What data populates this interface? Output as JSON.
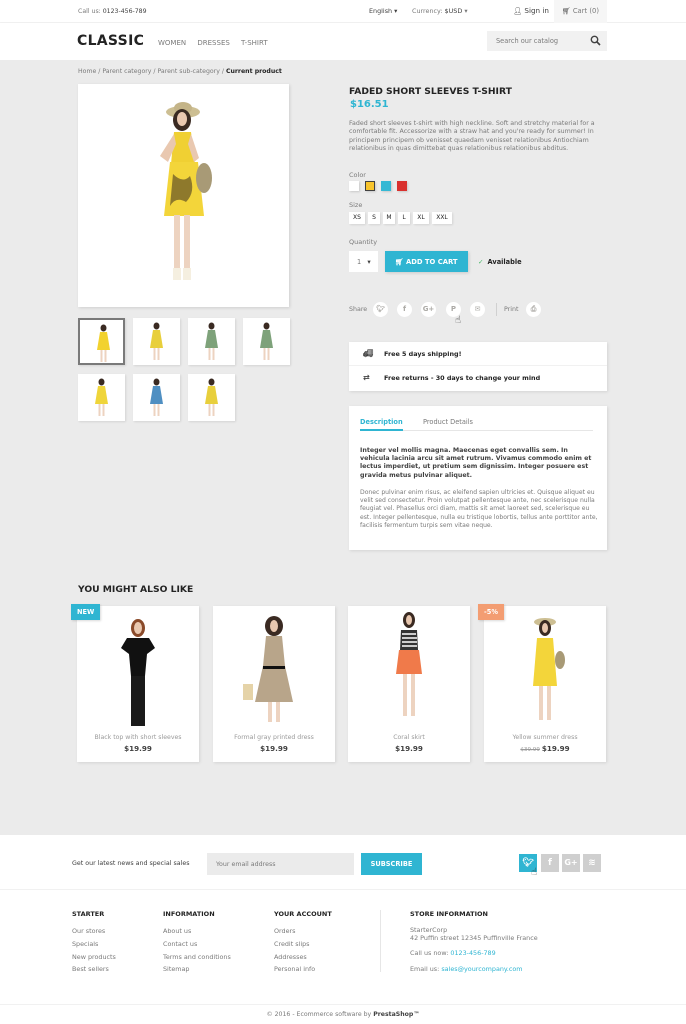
{
  "topbar": {
    "call_label": "Call us:",
    "phone": "0123-456-789",
    "language": "English",
    "currency_label": "Currency:",
    "currency_value": "$USD",
    "sign_in": "Sign in",
    "cart": "Cart (0)"
  },
  "header": {
    "logo": "CLASSIC",
    "nav": [
      "WOMEN",
      "DRESSES",
      "T-SHIRT"
    ],
    "search_placeholder": "Search our catalog"
  },
  "breadcrumb": [
    "Home",
    "Parent category",
    "Parent sub-category",
    "Current product"
  ],
  "product": {
    "name": "FADED SHORT SLEEVES T-SHIRT",
    "price": "$16.51",
    "description": "Faded short sleeves t-shirt with high neckline. Soft and stretchy material for a comfortable fit. Accessorize with a straw hat and you're ready for summer! In principem principem ob venisset quaedam venisset relationibus Antiochiam relationibus in quas dimittebat quas relationibus relationibus abditus.",
    "color_label": "Color",
    "colors": [
      {
        "name": "White",
        "hex": "#ffffff",
        "selected": false
      },
      {
        "name": "Yellow",
        "hex": "#f8c42c",
        "selected": true
      },
      {
        "name": "Blue",
        "hex": "#35b8d4",
        "selected": false
      },
      {
        "name": "Red",
        "hex": "#d9312e",
        "selected": false
      }
    ],
    "size_label": "Size",
    "sizes": [
      "XS",
      "S",
      "M",
      "L",
      "XL",
      "XXL"
    ],
    "quantity_label": "Quantity",
    "quantity": "1",
    "add_to_cart": "ADD TO CART",
    "availability": "Available",
    "share_label": "Share",
    "share_icons": [
      "twitter",
      "facebook",
      "google-plus",
      "pinterest",
      "email"
    ],
    "print_label": "Print",
    "thumbnails": [
      {
        "dress": "#f2d22e",
        "selected": true
      },
      {
        "dress": "#e8cf3c",
        "selected": false
      },
      {
        "dress": "#7ea27a",
        "selected": false
      },
      {
        "dress": "#7ea27a",
        "selected": false
      },
      {
        "dress": "#efd53a",
        "selected": false
      },
      {
        "dress": "#4f8fc2",
        "selected": false
      },
      {
        "dress": "#e8cf3c",
        "selected": false
      }
    ]
  },
  "reassurance": [
    {
      "icon": "truck",
      "text": "Free 5 days shipping!"
    },
    {
      "icon": "swap",
      "text": "Free returns - 30 days to change your mind"
    }
  ],
  "tabs": {
    "items": [
      "Description",
      "Product Details"
    ],
    "active": 0,
    "lead": "Integer vel mollis magna. Maecenas eget convallis sem. In vehicula lacinia arcu sit amet rutrum. Vivamus commodo enim et lectus imperdiet, ut pretium sem dignissim. Integer posuere est gravida metus pulvinar aliquet.",
    "body": "Donec pulvinar enim risus, ac eleifend sapien ultricies et. Quisque aliquet eu velit sed consectetur. Proin volutpat pellentesque ante, nec scelerisque nulla feugiat vel. Phasellus orci diam, mattis sit amet laoreet sed, scelerisque eu est. Integer pellentesque, nulla eu tristique lobortis, tellus ante porttitor ante, facilisis fermentum turpis sem vitae neque."
  },
  "related": {
    "title": "YOU MIGHT ALSO LIKE",
    "items": [
      {
        "name": "Black top with short sleeves",
        "price": "$19.99",
        "old_price": "",
        "badge": "NEW",
        "badge_color": "#2fb5d2"
      },
      {
        "name": "Formal gray printed dress",
        "price": "$19.99",
        "old_price": "",
        "badge": "",
        "badge_color": ""
      },
      {
        "name": "Coral skirt",
        "price": "$19.99",
        "old_price": "",
        "badge": "",
        "badge_color": ""
      },
      {
        "name": "Yellow summer dress",
        "price": "$19.99",
        "old_price": "$39.99",
        "badge": "-5%",
        "badge_color": "#f39d72"
      }
    ]
  },
  "newsletter": {
    "text": "Get our latest news and special sales",
    "placeholder": "Your email address",
    "button": "SUBSCRIBE",
    "social": [
      "twitter",
      "facebook",
      "google-plus",
      "rss"
    ]
  },
  "footer": {
    "columns": [
      {
        "title": "STARTER",
        "links": [
          "Our stores",
          "Specials",
          "New products",
          "Best sellers"
        ]
      },
      {
        "title": "INFORMATION",
        "links": [
          "About us",
          "Contact us",
          "Terms and conditions",
          "Sitemap"
        ]
      },
      {
        "title": "YOUR ACCOUNT",
        "links": [
          "Orders",
          "Credit slips",
          "Addresses",
          "Personal info"
        ]
      }
    ],
    "store": {
      "title": "STORE INFORMATION",
      "name": "StarterCorp",
      "address": "42 Puffin street 12345 Puffinville France",
      "call_label": "Call us now:",
      "phone": "0123-456-789",
      "email_label": "Email us:",
      "email": "sales@yourcompany.com"
    },
    "copyright": "© 2016 - Ecommerce software by",
    "brand": "PrestaShop™"
  },
  "colors": {
    "accent": "#2fb5d2",
    "background": "#ebebeb"
  }
}
